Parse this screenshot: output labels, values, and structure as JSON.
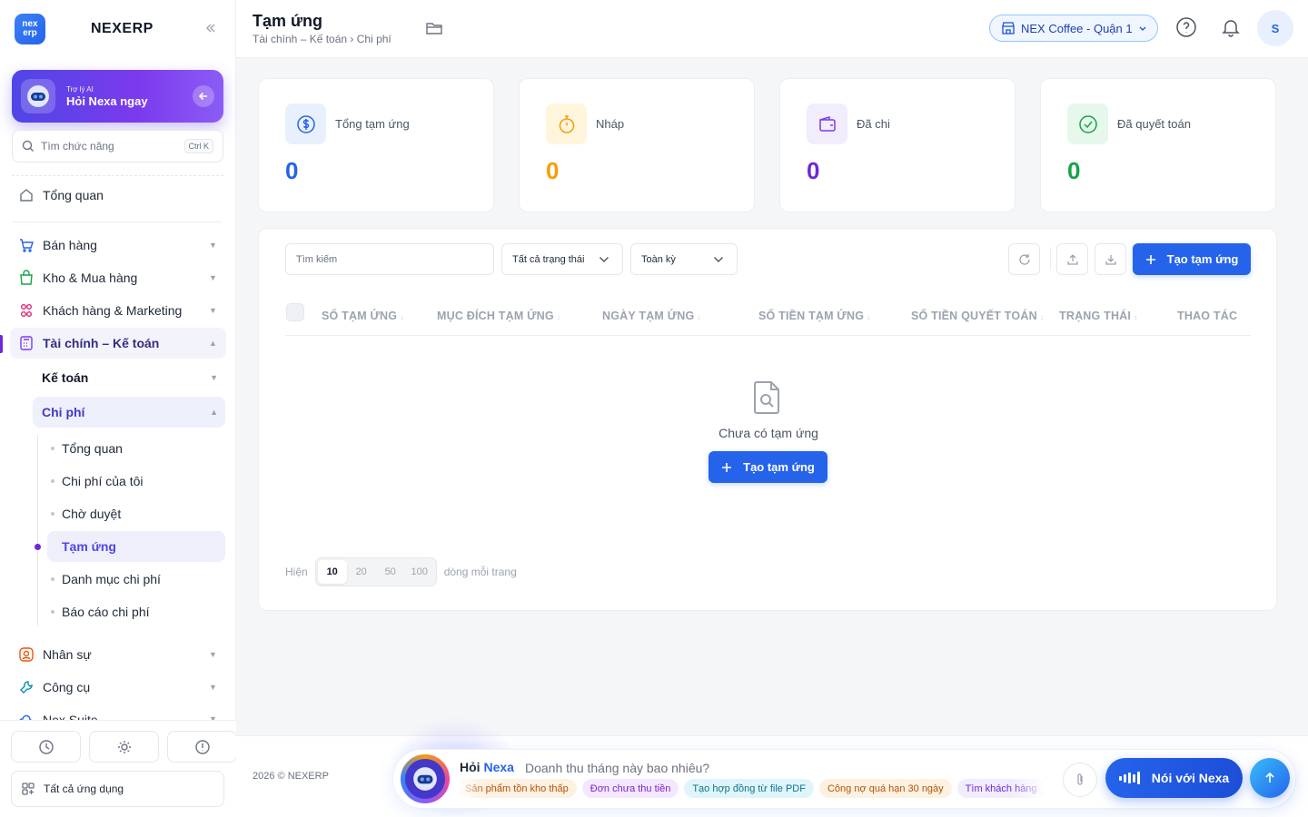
{
  "sidebar": {
    "logo_text_top": "nex",
    "logo_text_bottom": "erp",
    "brand": "NEXERP",
    "ai": {
      "small": "Trợ lý AI",
      "title": "Hỏi Nexa ngay"
    },
    "search": {
      "placeholder": "Tìm chức năng",
      "shortcut": "Ctrl K"
    },
    "overview": "Tổng quan",
    "menu": [
      {
        "label": "Bán hàng",
        "icon": "cart-icon"
      },
      {
        "label": "Kho & Mua hàng",
        "icon": "bag-icon"
      },
      {
        "label": "Khách hàng & Marketing",
        "icon": "people-icon"
      },
      {
        "label": "Tài chính – Kế toán",
        "icon": "calculator-icon",
        "active": true
      }
    ],
    "sub_accounting": "Kế toán",
    "sub_expense": "Chi phí",
    "leaves": [
      "Tổng quan",
      "Chi phí của tôi",
      "Chờ duyệt",
      "Tạm ứng",
      "Danh mục chi phí",
      "Báo cáo chi phí"
    ],
    "menu_after": [
      {
        "label": "Nhân sự",
        "icon": "person-icon"
      },
      {
        "label": "Công cụ",
        "icon": "wrench-icon"
      },
      {
        "label": "Nex Suite",
        "icon": "cloud-icon"
      }
    ],
    "all_apps": "Tất cả ứng dụng"
  },
  "header": {
    "title": "Tạm ứng",
    "breadcrumb": "Tài chính – Kế toán › Chi phí",
    "store": "NEX Coffee - Quận 1",
    "avatar": "S"
  },
  "stats": [
    {
      "label": "Tổng tạm ứng",
      "value": "0",
      "color": "#2563eb",
      "bg": "#e8f0fe",
      "icon": "dollar-icon"
    },
    {
      "label": "Nháp",
      "value": "0",
      "color": "#f59e0b",
      "bg": "#fef5dc",
      "icon": "stopwatch-icon"
    },
    {
      "label": "Đã chi",
      "value": "0",
      "color": "#6d28d9",
      "bg": "#f1edfd",
      "icon": "wallet-icon"
    },
    {
      "label": "Đã quyết toán",
      "value": "0",
      "color": "#16a34a",
      "bg": "#e6f7ec",
      "icon": "check-circle-icon"
    }
  ],
  "filters": {
    "search_placeholder": "Tìm kiếm",
    "status": "Tất cả trạng thái",
    "period": "Toàn kỳ",
    "create_label": "Tạo tạm ứng"
  },
  "table": {
    "columns": [
      "SỐ TẠM ỨNG",
      "MỤC ĐÍCH TẠM ỨNG",
      "NGÀY TẠM ỨNG",
      "SỐ TIỀN TẠM ỨNG",
      "SỐ TIỀN QUYẾT TOÁN",
      "TRẠNG THÁI",
      "THAO TÁC"
    ],
    "sort_glyph": "↕",
    "empty_text": "Chưa có tạm ứng",
    "empty_button": "Tạo tạm ứng"
  },
  "pager": {
    "before": "Hiện",
    "sizes": [
      "10",
      "20",
      "50",
      "100"
    ],
    "selected": "10",
    "after": "dòng mỗi trang"
  },
  "footer": {
    "copyright": "2026 © NEXERP",
    "ask_prefix": "Hỏi",
    "ask_name": "Nexa",
    "question": "Doanh thu tháng này bao nhiêu?",
    "chips": [
      {
        "text": "Sản phẩm tồn kho thấp",
        "fg": "#b45309",
        "bg": "#fdf1e1"
      },
      {
        "text": "Đơn chưa thu tiền",
        "fg": "#7e22ce",
        "bg": "#f3e8ff"
      },
      {
        "text": "Tạo hợp đồng từ file PDF",
        "fg": "#0e7490",
        "bg": "#e0f5f9"
      },
      {
        "text": "Công nợ quá hạn 30 ngày",
        "fg": "#b45309",
        "bg": "#fdf1e1"
      },
      {
        "text": "Tìm khách hàng",
        "fg": "#6d28d9",
        "bg": "#f1edfd"
      }
    ],
    "talk_label": "Nói với Nexa"
  }
}
